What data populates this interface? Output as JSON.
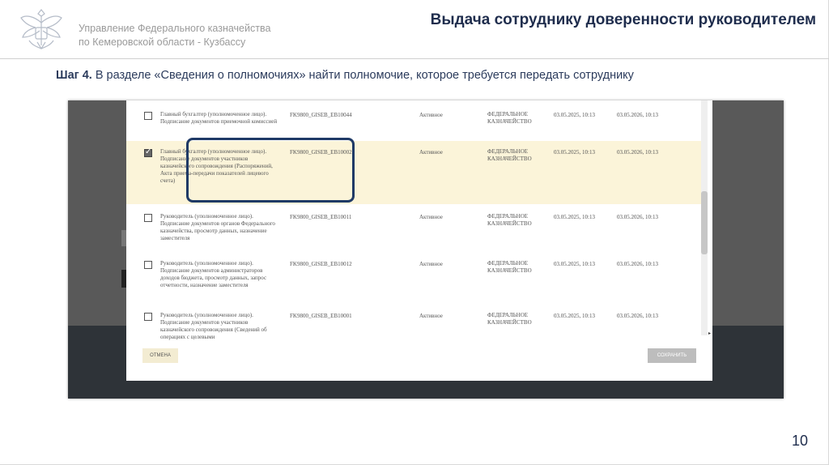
{
  "header": {
    "org_line1": "Управление Федерального казначейства",
    "org_line2": "по Кемеровской области - Кузбассу",
    "title": "Выдача сотруднику доверенности руководителем"
  },
  "step": {
    "label": "Шаг 4.",
    "text": " В разделе «Сведения о полномочиях» найти полномочие, которое требуется передать сотруднику"
  },
  "dialog": {
    "rows": [
      {
        "checked": false,
        "name": "Главный бухгалтер (уполномоченное лицо). Подписание документов приемочной комиссией",
        "code": "FK9800_GISEB_EB10044",
        "status": "Активное",
        "org": "ФЕДЕРАЛЬНОЕ КАЗНАЧЕЙСТВО",
        "from": "03.05.2025, 10:13",
        "to": "03.05.2026, 10:13"
      },
      {
        "checked": true,
        "name": "Главный бухгалтер (уполномоченное лицо). Подписание документов участников казначейского сопровождения (Распоряжений, Акта приема-передачи показателей лицевого счета)",
        "code": "FK9800_GISEB_EB10002",
        "status": "Активное",
        "org": "ФЕДЕРАЛЬНОЕ КАЗНАЧЕЙСТВО",
        "from": "03.05.2025, 10:13",
        "to": "03.05.2026, 10:13"
      },
      {
        "checked": false,
        "name": "Руководитель (уполномоченное лицо). Подписание документов органов Федерального казначейства, просмотр данных, назначение заместителя",
        "code": "FK9800_GISEB_EB10011",
        "status": "Активное",
        "org": "ФЕДЕРАЛЬНОЕ КАЗНАЧЕЙСТВО",
        "from": "03.05.2025, 10:13",
        "to": "03.05.2026, 10:13"
      },
      {
        "checked": false,
        "name": "Руководитель (уполномоченное лицо). Подписание документов администраторов доходов бюджета, просмотр данных, запрос отчетности, назначение заместителя",
        "code": "FK9800_GISEB_EB10012",
        "status": "Активное",
        "org": "ФЕДЕРАЛЬНОЕ КАЗНАЧЕЙСТВО",
        "from": "03.05.2025, 10:13",
        "to": "03.05.2026, 10:13"
      },
      {
        "checked": false,
        "name": "Руководитель (уполномоченное лицо). Подписание документов участников казначейского сопровождения (Сведений об операциях с целевыми",
        "code": "FK9800_GISEB_EB10001",
        "status": "Активное",
        "org": "ФЕДЕРАЛЬНОЕ КАЗНАЧЕЙСТВО",
        "from": "03.05.2025, 10:13",
        "to": "03.05.2026, 10:13"
      }
    ],
    "cancel_label": "ОТМЕНА",
    "save_label": "СОХРАНИТЬ"
  },
  "page_number": "10",
  "colors": {
    "title": "#1f2d4d",
    "highlight_border": "#1f3a66",
    "selected_row": "#fbf4d9"
  }
}
